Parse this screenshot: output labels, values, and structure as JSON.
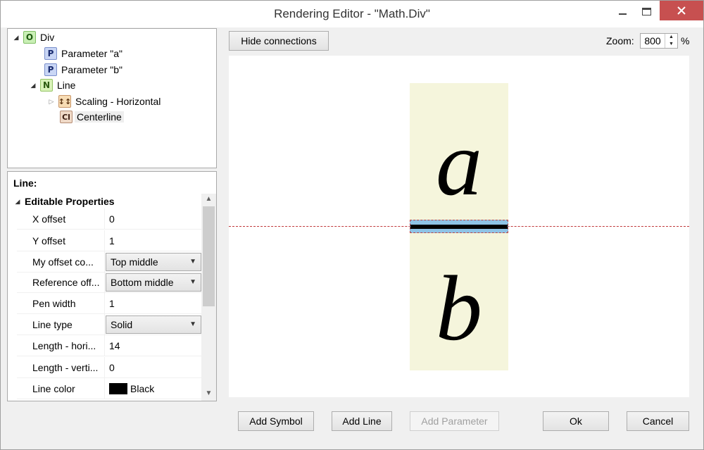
{
  "window": {
    "title": "Rendering Editor - \"Math.Div\""
  },
  "tree": {
    "nodes": [
      {
        "label": "Div",
        "icon": "O"
      },
      {
        "label": "Parameter \"a\"",
        "icon": "P"
      },
      {
        "label": "Parameter \"b\"",
        "icon": "P"
      },
      {
        "label": "Line",
        "icon": "N"
      },
      {
        "label": "Scaling - Horizontal",
        "icon": "↕↕"
      },
      {
        "label": "Centerline",
        "icon": "Cl"
      }
    ]
  },
  "props": {
    "title": "Line:",
    "category": "Editable Properties",
    "rows": [
      {
        "name": "X offset",
        "value": "0"
      },
      {
        "name": "Y offset",
        "value": "1"
      },
      {
        "name": "My offset co...",
        "value": "Top middle"
      },
      {
        "name": "Reference off...",
        "value": "Bottom middle"
      },
      {
        "name": "Pen width",
        "value": "1"
      },
      {
        "name": "Line type",
        "value": "Solid"
      },
      {
        "name": "Length - hori...",
        "value": "14"
      },
      {
        "name": "Length - verti...",
        "value": "0"
      },
      {
        "name": "Line color",
        "value": "Black"
      }
    ]
  },
  "toolbar": {
    "hide_connections": "Hide connections",
    "zoom_label": "Zoom:",
    "zoom_value": "800",
    "zoom_unit": "%"
  },
  "canvas": {
    "top_symbol": "a",
    "bottom_symbol": "b"
  },
  "buttons": {
    "add_symbol": "Add Symbol",
    "add_line": "Add Line",
    "add_parameter": "Add Parameter",
    "ok": "Ok",
    "cancel": "Cancel"
  },
  "colors": {
    "symbol_background": "#f5f5dc",
    "selection_highlight": "#8fc3e6",
    "connection_line": "#c0393b"
  }
}
